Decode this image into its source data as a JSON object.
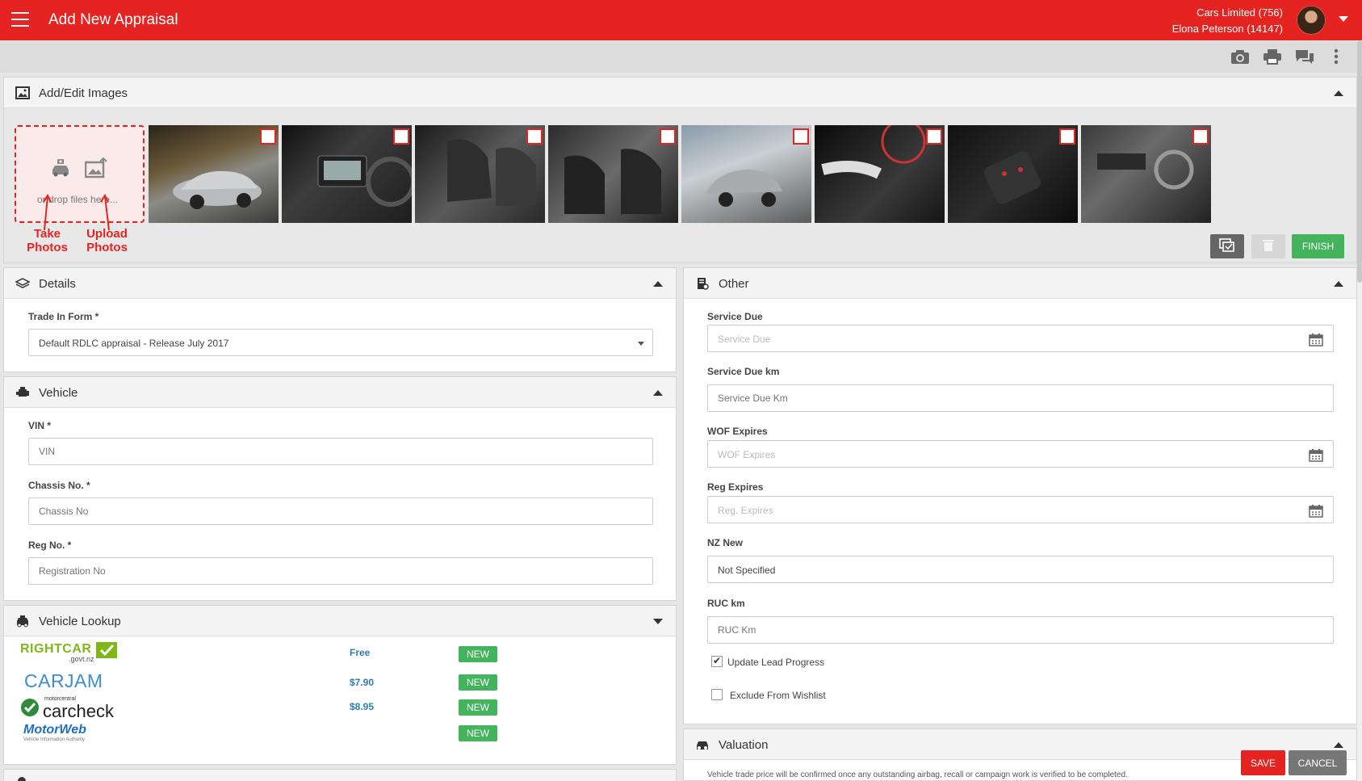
{
  "header": {
    "title": "Add New Appraisal",
    "company": "Cars Limited (756)",
    "user": "Elona Peterson (14147)"
  },
  "toolbar": {
    "icons": [
      "camera-icon",
      "print-icon",
      "chat-icon",
      "more-vertical-icon"
    ]
  },
  "images": {
    "title": "Add/Edit Images",
    "drop_text": "or drop files here...",
    "annotation_take": "Take Photos",
    "annotation_upload": "Upload Photos",
    "photo_count": 8,
    "finish_label": "FINISH"
  },
  "details": {
    "title": "Details",
    "trade_in_label": "Trade In Form *",
    "trade_in_value": "Default RDLC appraisal - Release July 2017"
  },
  "vehicle": {
    "title": "Vehicle",
    "vin_label": "VIN *",
    "vin_placeholder": "VIN",
    "chassis_label": "Chassis No. *",
    "chassis_placeholder": "Chassis No",
    "reg_label": "Reg No. *",
    "reg_placeholder": "Registration No"
  },
  "lookup": {
    "title": "Vehicle Lookup",
    "providers": [
      {
        "name": "RIGHTCAR",
        "sub": ".govt.nz",
        "price": "Free",
        "badge": "NEW"
      },
      {
        "name": "CARJAM",
        "price": "$7.90",
        "badge": "NEW"
      },
      {
        "name": "carcheck",
        "sub": "motorcentral",
        "price": "$8.95",
        "badge": "NEW"
      },
      {
        "name": "MotorWeb",
        "sub": "Vehicle Information Authority",
        "price": "",
        "badge": "NEW"
      }
    ]
  },
  "other": {
    "title": "Other",
    "service_due_label": "Service Due",
    "service_due_placeholder": "Service Due",
    "service_km_label": "Service Due km",
    "service_km_placeholder": "Service Due Km",
    "wof_label": "WOF Expires",
    "wof_placeholder": "WOF Expires",
    "reg_exp_label": "Reg Expires",
    "reg_exp_placeholder": "Reg. Expires",
    "nz_new_label": "NZ New",
    "nz_new_value": "Not Specified",
    "ruc_label": "RUC km",
    "ruc_placeholder": "RUC Km",
    "update_lead_label": "Update Lead Progress",
    "update_lead_checked": true,
    "exclude_wishlist_label": "Exclude From Wishlist",
    "exclude_wishlist_checked": false
  },
  "valuation": {
    "title": "Valuation",
    "note": "Vehicle trade price will be confirmed once any outstanding airbag, recall or campaign work is verified to be completed."
  },
  "actions": {
    "save_label": "SAVE",
    "cancel_label": "CANCEL"
  },
  "colors": {
    "brand": "#e52421",
    "success": "#43b35c",
    "link": "#2a7fb3"
  }
}
